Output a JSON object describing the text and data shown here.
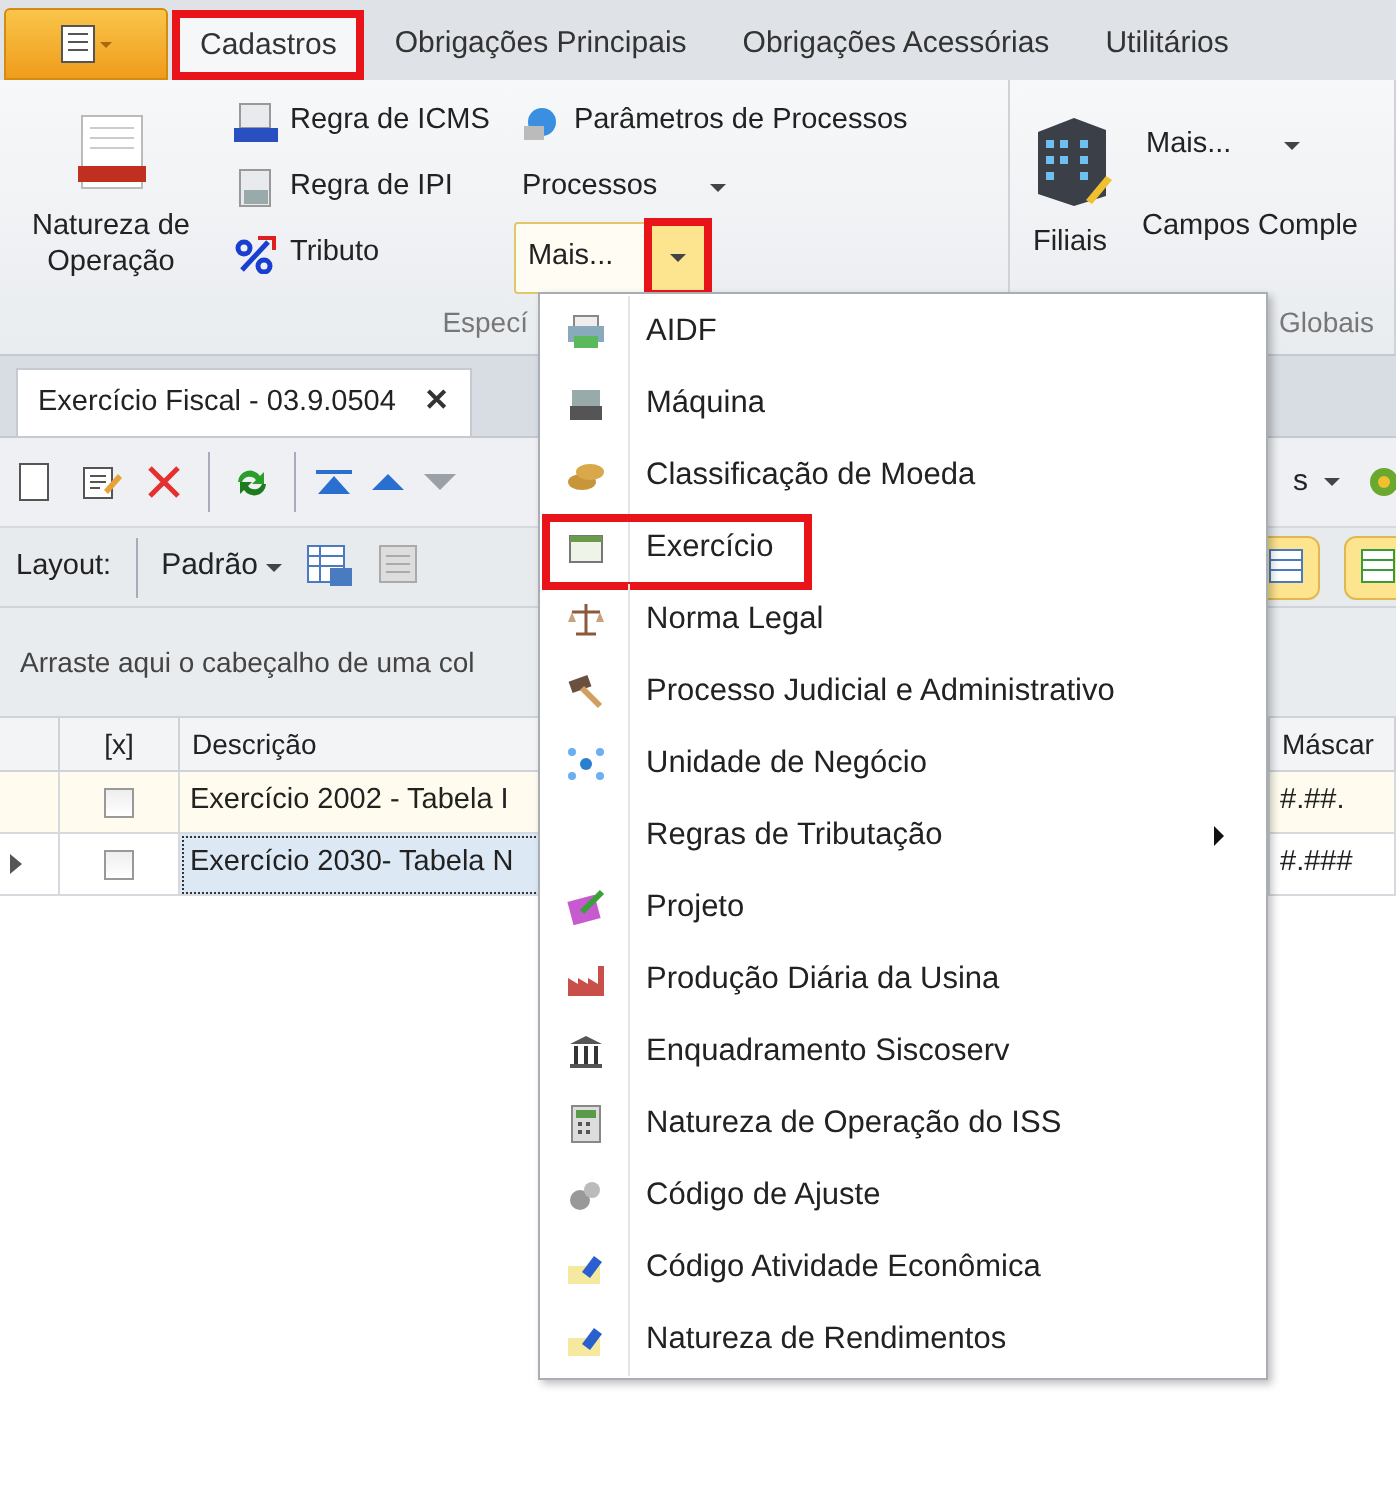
{
  "ribbon_tabs": [
    {
      "label": "Cadastros",
      "selected": true,
      "highlighted": true
    },
    {
      "label": "Obrigações Principais",
      "selected": false,
      "highlighted": false
    },
    {
      "label": "Obrigações Acessórias",
      "selected": false,
      "highlighted": false
    },
    {
      "label": "Utilitários",
      "selected": false,
      "highlighted": false
    }
  ],
  "ribbon_groups": [
    {
      "label": "Especí",
      "columns": [
        [
          {
            "kind": "large",
            "label": "Natureza de Operação"
          }
        ],
        [
          {
            "kind": "small",
            "label": "Regra de ICMS"
          },
          {
            "kind": "small",
            "label": "Regra de IPI"
          },
          {
            "kind": "small",
            "label": "Tributo"
          }
        ],
        [
          {
            "kind": "small",
            "label": "Parâmetros de Processos"
          },
          {
            "kind": "dropdown",
            "label": "Processos"
          },
          {
            "kind": "split",
            "label": "Mais...",
            "open": true,
            "highlighted": true
          }
        ]
      ]
    },
    {
      "label": "Globais",
      "columns": [
        [
          {
            "kind": "large",
            "label": "Filiais"
          }
        ],
        [
          {
            "kind": "dropdown",
            "label": "Mais..."
          },
          {
            "kind": "text",
            "label": "Campos Comple"
          }
        ]
      ]
    }
  ],
  "document_tab": {
    "label": "Exercício Fiscal - 03.9.0504",
    "close": "✕",
    "selected": true
  },
  "toolbar": {
    "label": "s"
  },
  "layout_bar": {
    "label": "Layout:",
    "preset": "Padrão"
  },
  "group_panel": {
    "text": "Arraste aqui o cabeçalho de uma col"
  },
  "grid": {
    "columns": [
      "[x]",
      "Descrição",
      "Máscar"
    ],
    "rows": [
      {
        "current": false,
        "checked": false,
        "description": "Exercício 2002 - Tabela I",
        "mask": "#.##."
      },
      {
        "current": true,
        "checked": false,
        "description": "Exercício 2030- Tabela N",
        "mask": "#.###"
      }
    ]
  },
  "menu": {
    "items": [
      {
        "label": "AIDF",
        "submenu": false,
        "highlighted": false
      },
      {
        "label": "Máquina",
        "submenu": false,
        "highlighted": false
      },
      {
        "label": "Classificação de Moeda",
        "submenu": false,
        "highlighted": false
      },
      {
        "label": "Exercício",
        "submenu": false,
        "highlighted": true
      },
      {
        "label": "Norma Legal",
        "submenu": false,
        "highlighted": false
      },
      {
        "label": "Processo Judicial e Administrativo",
        "submenu": false,
        "highlighted": false
      },
      {
        "label": "Unidade de Negócio",
        "submenu": false,
        "highlighted": false
      },
      {
        "label": "Regras de Tributação",
        "submenu": true,
        "highlighted": false
      },
      {
        "label": "Projeto",
        "submenu": false,
        "highlighted": false
      },
      {
        "label": "Produção Diária da Usina",
        "submenu": false,
        "highlighted": false
      },
      {
        "label": "Enquadramento Siscoserv",
        "submenu": false,
        "highlighted": false
      },
      {
        "label": "Natureza de Operação do ISS",
        "submenu": false,
        "highlighted": false
      },
      {
        "label": "Código de Ajuste",
        "submenu": false,
        "highlighted": false
      },
      {
        "label": "Código Atividade Econômica",
        "submenu": false,
        "highlighted": false
      },
      {
        "label": "Natureza de Rendimentos",
        "submenu": false,
        "highlighted": false
      }
    ]
  }
}
